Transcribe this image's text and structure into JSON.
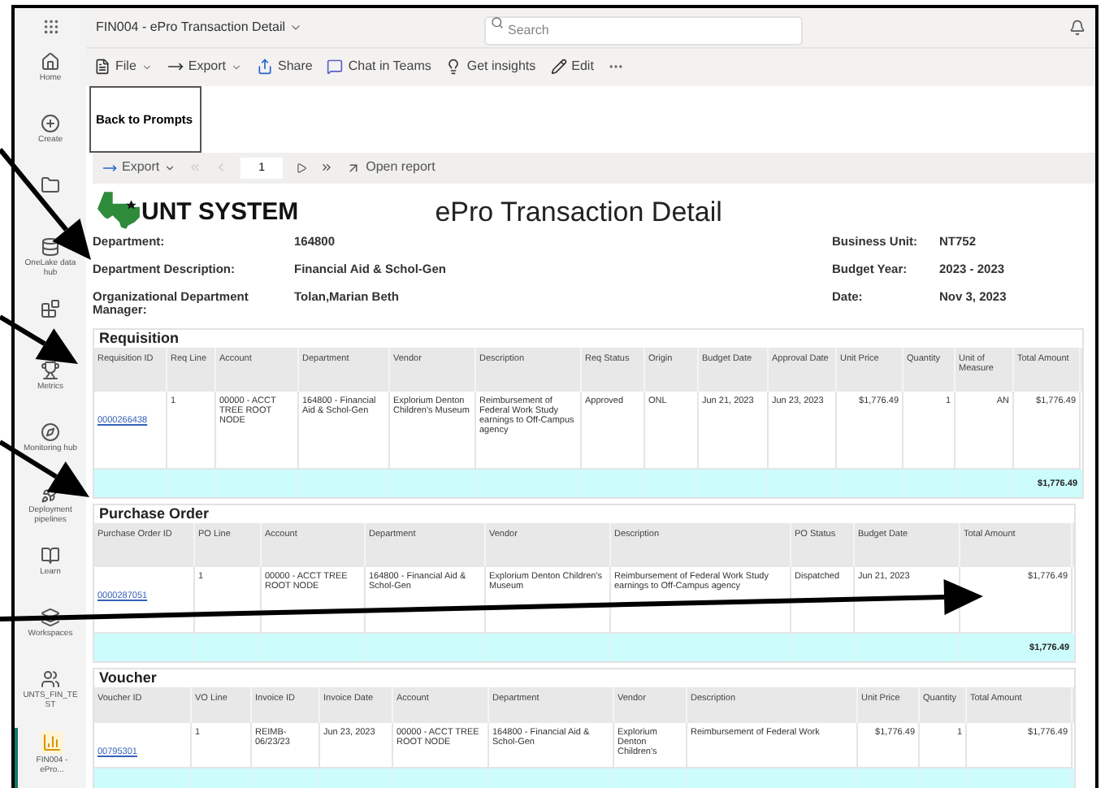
{
  "app_bar": {
    "report_name": "FIN004 - ePro Transaction Detail",
    "search": {
      "placeholder": "Search"
    }
  },
  "sidebar": {
    "items": [
      {
        "label": "Home",
        "selected": false
      },
      {
        "label": "Create",
        "selected": false
      },
      {
        "selected": false
      },
      {
        "label": "OneLake data hub",
        "selected": false
      },
      {
        "selected": false
      },
      {
        "label": "Metrics",
        "selected": false
      },
      {
        "label": "Monitoring hub",
        "selected": false
      },
      {
        "label": "Deployment pipelines",
        "selected": false
      },
      {
        "label": "Learn",
        "selected": false
      },
      {
        "label": "Workspaces",
        "selected": false
      },
      {
        "label": "UNTS_FIN_TEST",
        "selected": false
      },
      {
        "label": "FIN004 - ePro...",
        "selected": true
      }
    ]
  },
  "toolbar": {
    "items": [
      {
        "label": "File",
        "dropdown": true
      },
      {
        "label": "Export",
        "dropdown": true
      },
      {
        "label": "Share",
        "dropdown": false
      },
      {
        "label": "Chat in Teams",
        "dropdown": false
      },
      {
        "label": "Get insights",
        "dropdown": false
      },
      {
        "label": "Edit",
        "dropdown": false
      }
    ]
  },
  "back_button": "Back to Prompts",
  "report_toolbar": {
    "export": "Export",
    "page": "1",
    "open_report": "Open report"
  },
  "report": {
    "logo_text": "UNT SYSTEM",
    "title": "ePro Transaction Detail",
    "fields_left": [
      {
        "label": "Department:",
        "value": "164800"
      },
      {
        "label": "Department Description:",
        "value": "Financial Aid & Schol-Gen"
      },
      {
        "label": "Organizational Department Manager:",
        "value": "Tolan,Marian Beth"
      }
    ],
    "fields_right": [
      {
        "label": "Business Unit:",
        "value": "NT752"
      },
      {
        "label": "Budget Year:",
        "value": "2023 - 2023"
      },
      {
        "label": "Date:",
        "value": "Nov 3, 2023"
      }
    ]
  },
  "sections": [
    {
      "title": "Requisition",
      "columns": [
        "Requisition ID",
        "Req Line",
        "Account",
        "Department",
        "Vendor",
        "Description",
        "Req Status",
        "Origin",
        "Budget Date",
        "Approval Date",
        "Unit Price",
        "Quantity",
        "Unit of Measure",
        "Total Amount"
      ],
      "rows": [
        [
          "0000266438",
          "1",
          "00000 - ACCT TREE ROOT NODE",
          "164800 - Financial Aid & Schol-Gen",
          "Explorium Denton Children's Museum",
          "Reimbursement of Federal Work Study earnings to Off-Campus agency",
          "Approved",
          "ONL",
          "Jun 21, 2023",
          "Jun 23, 2023",
          "$1,776.49",
          "1",
          "AN",
          "$1,776.49"
        ]
      ],
      "total": "$1,776.49"
    },
    {
      "title": "Purchase Order",
      "columns": [
        "Purchase Order ID",
        "PO Line",
        "Account",
        "Department",
        "Vendor",
        "Description",
        "PO Status",
        "Budget Date",
        "Total Amount"
      ],
      "rows": [
        [
          "0000287051",
          "1",
          "00000 - ACCT TREE ROOT NODE",
          "164800 - Financial Aid & Schol-Gen",
          "Explorium Denton Children's Museum",
          "Reimbursement of Federal Work Study earnings to Off-Campus agency",
          "Dispatched",
          "Jun 21, 2023",
          "$1,776.49"
        ]
      ],
      "total": "$1,776.49"
    },
    {
      "title": "Voucher",
      "columns": [
        "Voucher ID",
        "VO Line",
        "Invoice ID",
        "Invoice Date",
        "Account",
        "Department",
        "Vendor",
        "Description",
        "Unit Price",
        "Quantity",
        "Total Amount"
      ],
      "rows": [
        [
          "00795301",
          "1",
          "REIMB-06/23/23",
          "Jun 23, 2023",
          "00000 - ACCT TREE ROOT NODE",
          "164800 - Financial Aid & Schol-Gen",
          "Explorium Denton Children's",
          "Reimbursement of Federal Work",
          "$1,776.49",
          "1",
          "$1,776.49"
        ]
      ]
    }
  ]
}
